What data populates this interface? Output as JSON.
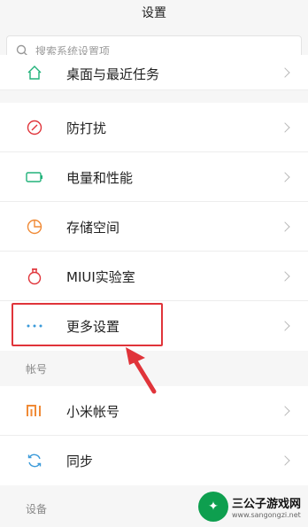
{
  "header": {
    "title": "设置"
  },
  "search": {
    "placeholder": "搜索系统设置项"
  },
  "rows": [
    {
      "label": "桌面与最近任务",
      "icon": "home-icon"
    },
    {
      "label": "防打扰",
      "icon": "do-not-disturb-icon"
    },
    {
      "label": "电量和性能",
      "icon": "battery-icon"
    },
    {
      "label": "存储空间",
      "icon": "storage-pie-icon"
    },
    {
      "label": "MIUI实验室",
      "icon": "lab-flask-icon"
    },
    {
      "label": "更多设置",
      "icon": "more-dots-icon"
    }
  ],
  "account_section": {
    "header": "帐号",
    "rows": [
      {
        "label": "小米帐号",
        "icon": "mi-logo-icon"
      },
      {
        "label": "同步",
        "icon": "sync-icon"
      }
    ]
  },
  "device_section": {
    "header": "设备"
  },
  "watermark": {
    "title": "三公子游戏网",
    "url": "www.sangongzi.net"
  },
  "colors": {
    "accent_red": "#e0343a",
    "icon_green": "#21b27a",
    "icon_orange": "#f08a36",
    "icon_blue": "#3a9ad9"
  }
}
